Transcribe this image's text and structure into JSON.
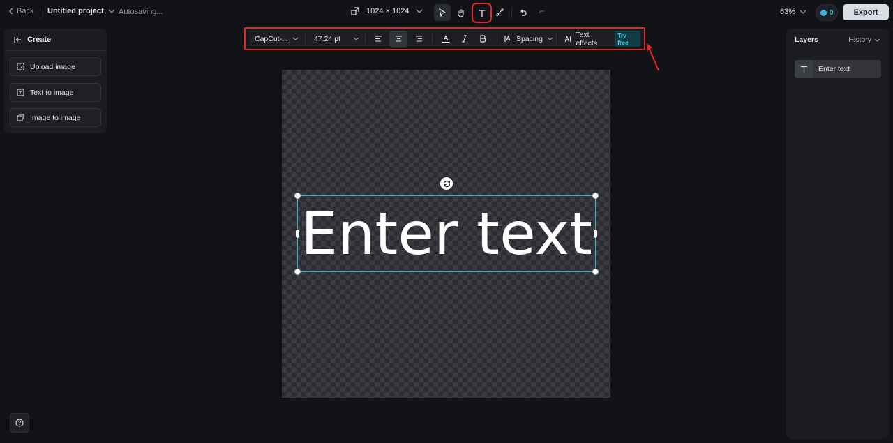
{
  "topbar": {
    "back_label": "Back",
    "project_title": "Untitled project",
    "autosave_status": "Autosaving...",
    "canvas_size": "1024 × 1024",
    "zoom": "63%",
    "credits": "0",
    "export_label": "Export"
  },
  "left_panel": {
    "title": "Create",
    "buttons": [
      {
        "label": "Upload image",
        "icon": "upload-image-icon"
      },
      {
        "label": "Text to image",
        "icon": "text-to-image-icon"
      },
      {
        "label": "Image to image",
        "icon": "image-to-image-icon"
      }
    ]
  },
  "text_toolbar": {
    "font": "CapCut-...",
    "font_size": "47.24 pt",
    "alignment": "center",
    "spacing_label": "Spacing",
    "effects_label": "Text effects",
    "try_free": "Try free"
  },
  "canvas": {
    "text": "Enter text"
  },
  "right_panel": {
    "layers_tab": "Layers",
    "history_tab": "History",
    "layers": [
      {
        "label": "Enter text",
        "type": "text"
      }
    ]
  },
  "colors": {
    "accent": "#27b6c8",
    "highlight": "#e2252c",
    "background": "#121317",
    "panel": "#1b1c21"
  }
}
